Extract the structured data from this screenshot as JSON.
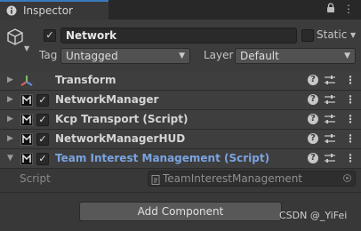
{
  "tabbar": {
    "tab_title": "Inspector",
    "tab_icon": "info-icon",
    "lock_icon": "lock-icon",
    "menu_icon": "kebab-icon"
  },
  "header": {
    "object_active": true,
    "object_name": "Network",
    "static_label": "Static",
    "static_checked": false,
    "tag_label": "Tag",
    "tag_value": "Untagged",
    "layer_label": "Layer",
    "layer_value": "Default"
  },
  "components": [
    {
      "title": "Transform",
      "icon": "transform-axes-icon",
      "has_checkbox": false,
      "expanded": false
    },
    {
      "title": "NetworkManager",
      "icon": "mirror-script-icon",
      "has_checkbox": true,
      "checked": true,
      "expanded": false
    },
    {
      "title": "Kcp Transport (Script)",
      "icon": "mirror-script-icon",
      "has_checkbox": true,
      "checked": true,
      "expanded": false
    },
    {
      "title": "NetworkManagerHUD",
      "icon": "mirror-script-icon",
      "has_checkbox": true,
      "checked": true,
      "expanded": false
    },
    {
      "title": "Team Interest Management (Script)",
      "icon": "mirror-script-icon",
      "has_checkbox": true,
      "checked": true,
      "expanded": true,
      "highlighted": true
    }
  ],
  "script_field": {
    "label": "Script",
    "value": "TeamInterestManagement"
  },
  "add_component_label": "Add Component",
  "watermark": "CSDN @_YiFei",
  "colors": {
    "tab_accent": "#3a79bb",
    "highlight_title": "#7aa3e0",
    "background": "#383838"
  }
}
